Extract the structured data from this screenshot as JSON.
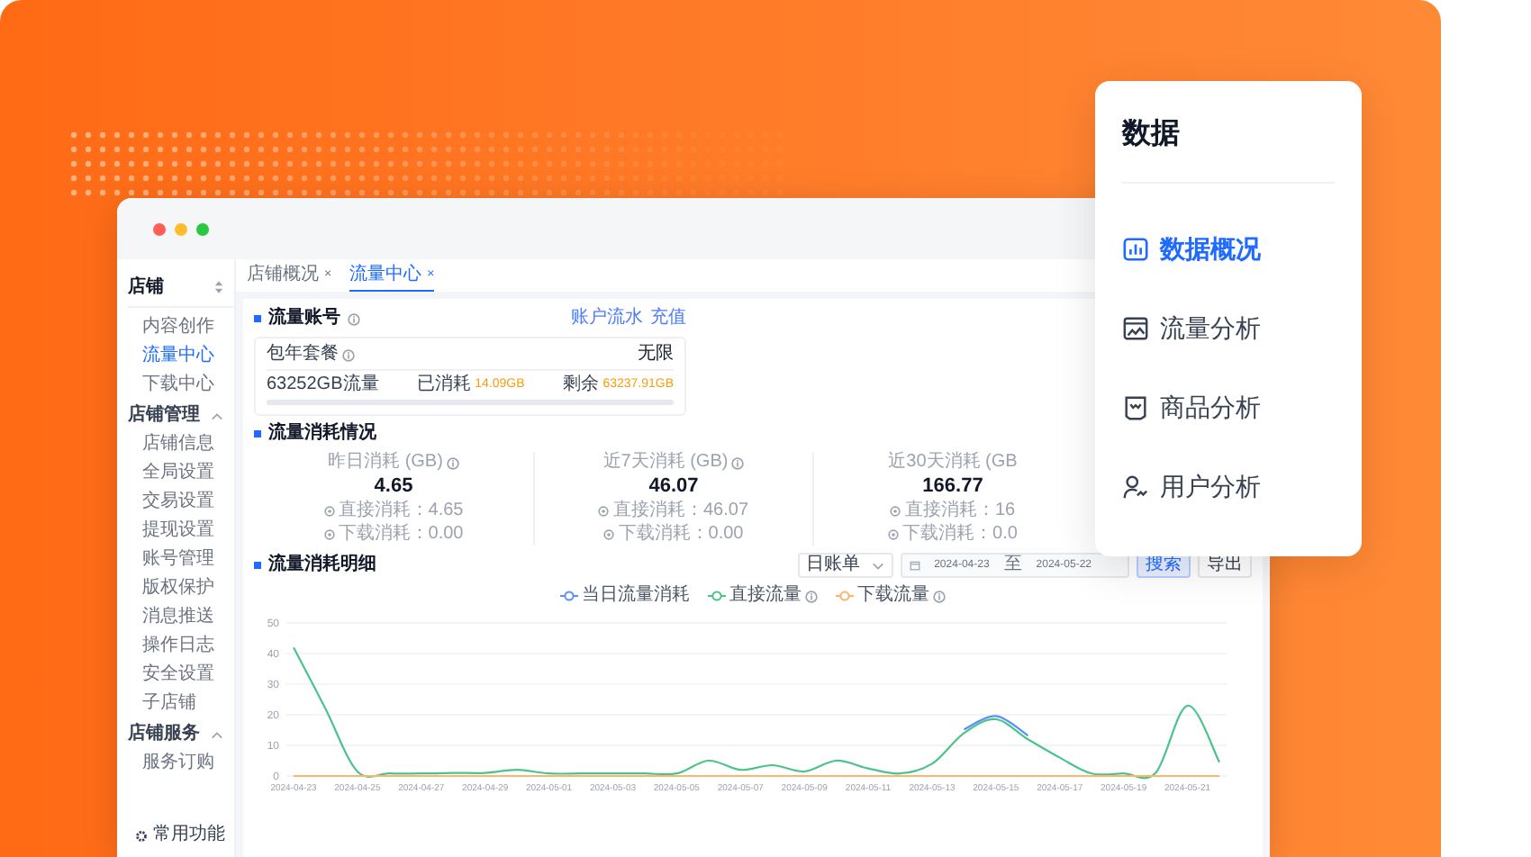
{
  "tabs": [
    {
      "label": "店铺概况",
      "close": "×",
      "selected": false
    },
    {
      "label": "流量中心",
      "close": "×",
      "selected": true
    }
  ],
  "sidebar": {
    "title": "店铺",
    "items": [
      {
        "kind": "link",
        "label": "内容创作",
        "selected": false
      },
      {
        "kind": "link",
        "label": "流量中心",
        "selected": true
      },
      {
        "kind": "link",
        "label": "下载中心",
        "selected": false
      },
      {
        "kind": "group",
        "label": "店铺管理",
        "expanded": true,
        "children": [
          {
            "label": "店铺信息",
            "selected": false
          },
          {
            "label": "全局设置",
            "selected": false
          },
          {
            "label": "交易设置",
            "selected": false
          },
          {
            "label": "提现设置",
            "selected": false
          },
          {
            "label": "账号管理",
            "selected": false
          },
          {
            "label": "版权保护",
            "selected": false
          },
          {
            "label": "消息推送",
            "selected": false
          },
          {
            "label": "操作日志",
            "selected": false
          },
          {
            "label": "安全设置",
            "selected": false
          },
          {
            "label": "子店铺",
            "selected": false
          }
        ]
      },
      {
        "kind": "group",
        "label": "店铺服务",
        "expanded": true,
        "children": [
          {
            "label": "服务订购",
            "selected": false
          }
        ]
      }
    ],
    "footer": "常用功能"
  },
  "account": {
    "title": "流量账号",
    "links": [
      "账户流水",
      "充值"
    ],
    "plan": "包年套餐",
    "validity": "无限",
    "quota": "63252GB流量",
    "used_label": "已消耗",
    "used": "14.09GB",
    "remaining_label": "剩余",
    "remaining": "63237.91GB",
    "level": 0.0002
  },
  "consumption": {
    "title": "流量消耗情况",
    "stats": [
      {
        "label": "昨日消耗 (GB)",
        "info_icon": true,
        "value": "4.65",
        "lines": [
          "直接消耗：4.65",
          "下载消耗：0.00"
        ]
      },
      {
        "label": "近7天消耗 (GB)",
        "info_icon": true,
        "value": "46.07",
        "lines": [
          "直接消耗：46.07",
          "下载消耗：0.00"
        ]
      },
      {
        "label": "近30天消耗 (GB",
        "info_icon": false,
        "value": "166.77",
        "lines": [
          "直接消耗：16",
          "下载消耗：0.0"
        ]
      }
    ]
  },
  "detail": {
    "title": "流量消耗明细",
    "period": "日账单",
    "start": "2024-04-23",
    "separator": "至",
    "end": "2024-05-22",
    "buttons": [
      {
        "label": "搜索",
        "primary": true
      },
      {
        "label": "导出",
        "primary": false
      }
    ],
    "legend_info": [
      false,
      true,
      true
    ],
    "chart_data": {
      "type": "line",
      "grid": true,
      "categories": [
        "2024-04-23",
        null,
        "2024-04-25",
        null,
        "2024-04-27",
        null,
        "2024-04-29",
        null,
        "2024-05-01",
        null,
        "2024-05-03",
        null,
        "2024-05-05",
        null,
        "2024-05-07",
        null,
        "2024-05-09",
        null,
        "2024-05-11",
        null,
        "2024-05-13",
        null,
        "2024-05-15",
        null,
        "2024-05-17",
        null,
        "2024-05-19",
        null,
        "2024-05-21",
        null
      ],
      "series": [
        {
          "name": "当日流量消耗",
          "color": "#5b8ff9",
          "values": [
            null,
            null,
            null,
            null,
            null,
            null,
            null,
            null,
            null,
            null,
            null,
            null,
            null,
            null,
            null,
            null,
            null,
            null,
            null,
            null,
            null,
            15.2,
            19.6,
            13.2,
            null,
            null,
            null,
            null,
            null,
            null
          ]
        },
        {
          "name": "直接流量",
          "color": "#4cc38a",
          "values": [
            42,
            22,
            1.5,
            0.8,
            0.8,
            1,
            1,
            2,
            0.8,
            0.8,
            0.8,
            0.8,
            0.8,
            5,
            2,
            3.5,
            1.5,
            5,
            2.5,
            0.8,
            4,
            14,
            18.5,
            12,
            6,
            0.8,
            0.8,
            1,
            23,
            4.5
          ]
        },
        {
          "name": "下载流量",
          "color": "#fdb46b",
          "values": [
            0,
            0,
            0,
            0,
            0,
            0,
            0,
            0,
            0,
            0,
            0,
            0,
            0,
            0,
            0,
            0,
            0,
            0,
            0,
            0,
            0,
            0,
            0,
            0,
            0,
            0,
            0,
            0,
            0,
            0
          ]
        }
      ],
      "ylim": [
        0,
        50
      ],
      "yticks": [
        0,
        10,
        20,
        30,
        40,
        50
      ]
    }
  },
  "panel": {
    "title": "数据",
    "items": [
      {
        "label": "数据概况",
        "selected": true
      },
      {
        "label": "流量分析",
        "selected": false
      },
      {
        "label": "商品分析",
        "selected": false
      },
      {
        "label": "用户分析",
        "selected": false
      }
    ]
  }
}
